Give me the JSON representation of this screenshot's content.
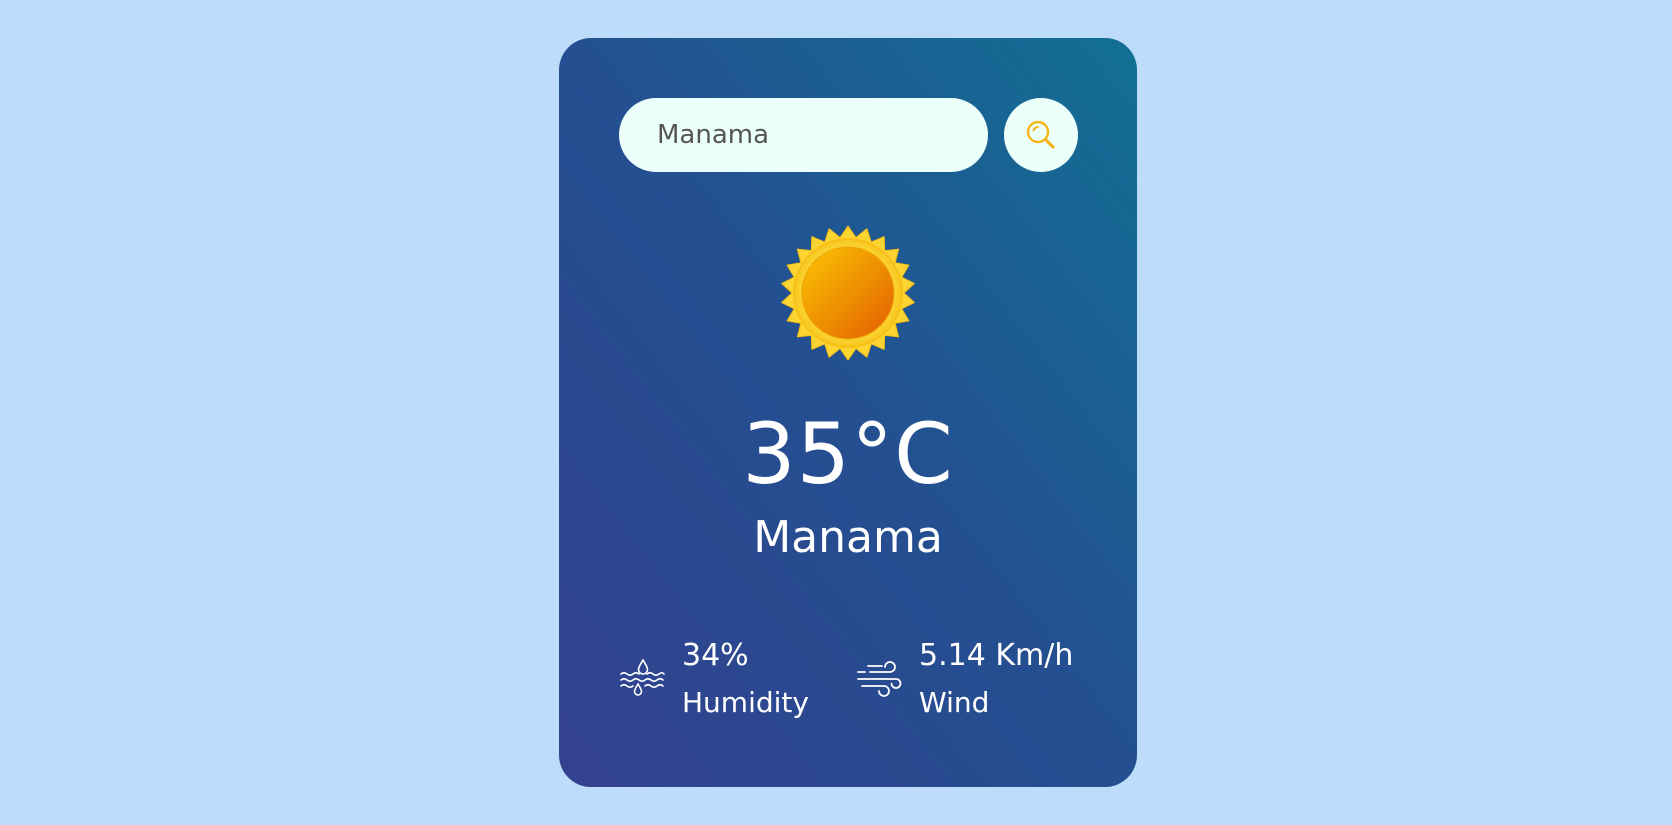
{
  "search": {
    "value": "Manama",
    "button_icon": "search-icon"
  },
  "weather": {
    "condition_icon": "sun-icon",
    "temperature": "35°C",
    "city": "Manama"
  },
  "details": {
    "humidity": {
      "icon": "humidity-icon",
      "value": "34%",
      "label": "Humidity"
    },
    "wind": {
      "icon": "wind-icon",
      "value": "5.14 Km/h",
      "label": "Wind"
    }
  },
  "colors": {
    "page_background": "#bddcf9",
    "card_gradient_start": "#33418f",
    "card_gradient_end": "#127094",
    "input_background": "#ebfffb",
    "search_icon_color": "#f4b41a",
    "text": "#ffffff"
  }
}
